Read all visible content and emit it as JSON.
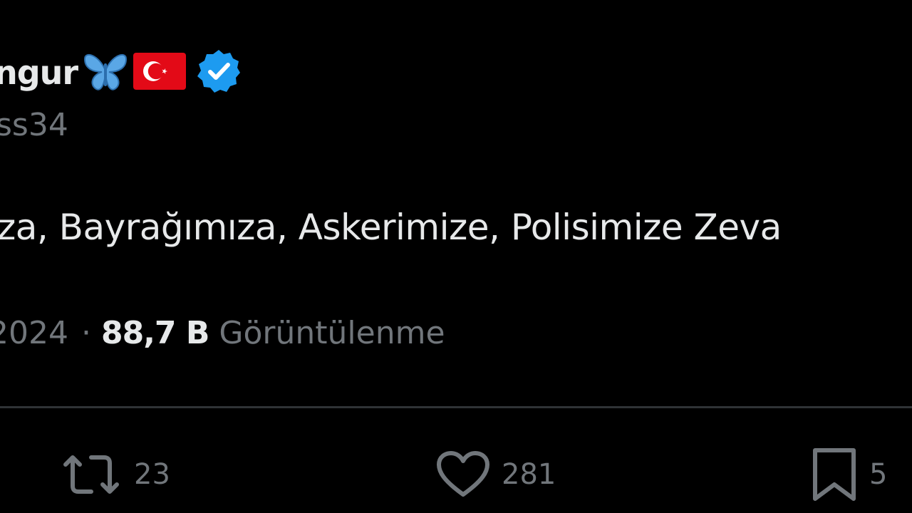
{
  "tweet": {
    "display_name": "ngur",
    "name_icons": [
      "butterfly-icon",
      "turkey-flag-icon",
      "verified-badge-icon"
    ],
    "handle": "ss34",
    "text": "za, Bayrağımıza, Askerimize, Polisimize Zeva",
    "date": "2024",
    "separator": "·",
    "views": "88,7 B",
    "views_label": "Görüntülenme"
  },
  "actions": {
    "retweet_count": "23",
    "like_count": "281",
    "bookmark_count": "5"
  },
  "colors": {
    "background": "#000000",
    "primary_text": "#e7e9ea",
    "secondary_text": "#71767b",
    "verified_blue": "#1d9bf0",
    "flag_red": "#e30a17",
    "divider": "#2f3336"
  }
}
